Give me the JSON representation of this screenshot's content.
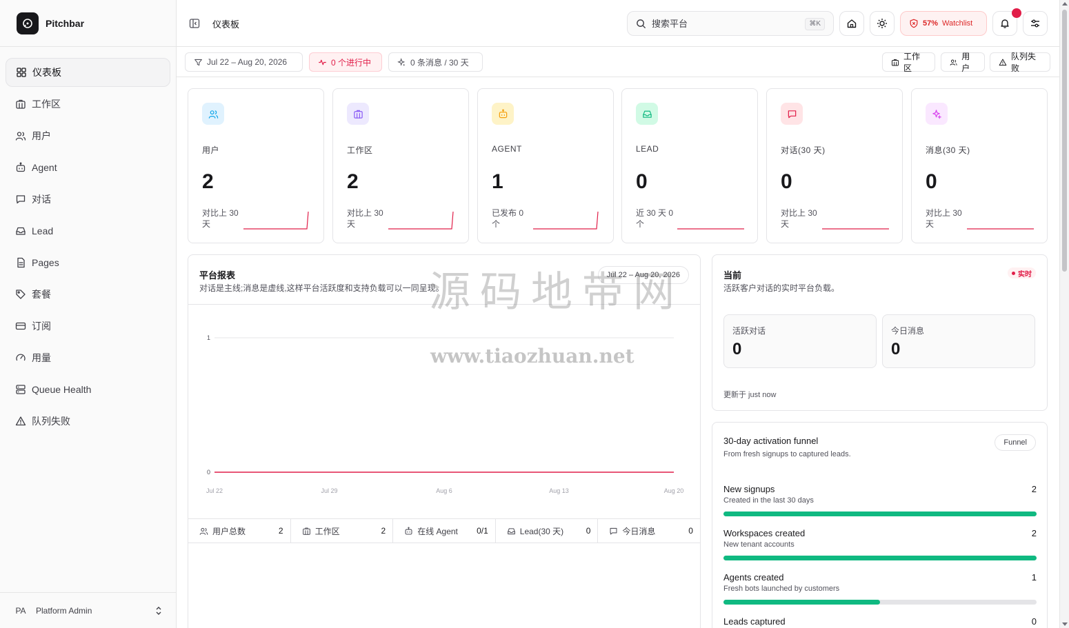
{
  "app": {
    "name": "Pitchbar",
    "page_title": "仪表板"
  },
  "sidebar": {
    "items": [
      {
        "label": "仪表板",
        "icon": "dashboard-icon",
        "active": true
      },
      {
        "label": "工作区",
        "icon": "building-icon"
      },
      {
        "label": "用户",
        "icon": "users-icon"
      },
      {
        "label": "Agent",
        "icon": "bot-icon"
      },
      {
        "label": "对话",
        "icon": "chat-icon"
      },
      {
        "label": "Lead",
        "icon": "inbox-icon"
      },
      {
        "label": "Pages",
        "icon": "document-icon"
      },
      {
        "label": "套餐",
        "icon": "tag-icon"
      },
      {
        "label": "订阅",
        "icon": "card-icon"
      },
      {
        "label": "用量",
        "icon": "gauge-icon"
      },
      {
        "label": "Queue Health",
        "icon": "server-icon"
      },
      {
        "label": "队列失败",
        "icon": "warning-icon"
      }
    ],
    "user": {
      "initials": "PA",
      "name": "Platform Admin"
    }
  },
  "header": {
    "search_placeholder": "搜索平台",
    "search_shortcut": "⌘K",
    "watchlist_percent": "57%",
    "watchlist_label": "Watchlist"
  },
  "filters": {
    "date_range": "Jul 22 – Aug 20, 2026",
    "in_progress": "0 个进行中",
    "messages": "0 条消息 / 30 天",
    "right_buttons": [
      "工作区",
      "用户",
      "队列失败"
    ]
  },
  "stats": [
    {
      "label": "用户",
      "value": "2",
      "note": "对比上 30 天",
      "icon": "users-icon",
      "color": "#0ea5e9",
      "bg": "#e0f2fe"
    },
    {
      "label": "工作区",
      "value": "2",
      "note": "对比上 30 天",
      "icon": "building-icon",
      "color": "#8b5cf6",
      "bg": "#ede9fe"
    },
    {
      "label": "AGENT",
      "value": "1",
      "note": "已发布 0 个",
      "icon": "bot-icon",
      "color": "#f59e0b",
      "bg": "#fef3c7"
    },
    {
      "label": "LEAD",
      "value": "0",
      "note": "近 30 天 0 个",
      "icon": "inbox-icon",
      "color": "#10b981",
      "bg": "#d1fae5"
    },
    {
      "label": "对话(30 天)",
      "value": "0",
      "note": "对比上 30 天",
      "icon": "chat-icon",
      "color": "#e11d48",
      "bg": "#ffe4e6"
    },
    {
      "label": "消息(30 天)",
      "value": "0",
      "note": "对比上 30 天",
      "icon": "sparkle-icon",
      "color": "#d946ef",
      "bg": "#fae8ff"
    }
  ],
  "report": {
    "title": "平台报表",
    "subtitle": "对话是主线;消息是虚线,这样平台活跃度和支持负载可以一同呈现。",
    "date_pill": "Jul 22 – Aug 20, 2026",
    "metrics": [
      {
        "label": "用户总数",
        "value": "2",
        "icon": "users-icon"
      },
      {
        "label": "工作区",
        "value": "2",
        "icon": "building-icon"
      },
      {
        "label": "在线 Agent",
        "value": "0/1",
        "icon": "bot-icon"
      },
      {
        "label": "Lead(30 天)",
        "value": "0",
        "icon": "inbox-icon"
      },
      {
        "label": "今日消息",
        "value": "0",
        "icon": "chat-icon"
      }
    ]
  },
  "chart_data": {
    "type": "line",
    "x_ticks": [
      "Jul 22",
      "Jul 29",
      "Aug 6",
      "Aug 13",
      "Aug 20"
    ],
    "y_ticks": [
      "0",
      "1"
    ],
    "ylim": [
      0,
      1
    ],
    "series": [
      {
        "values": [
          0,
          0,
          0,
          0,
          0
        ],
        "color": "#e11d48"
      }
    ],
    "grid": true
  },
  "live": {
    "title": "当前",
    "subtitle": "活跃客户对话的实时平台负载。",
    "badge": "实时",
    "active_label": "活跃对话",
    "active_value": "0",
    "today_label": "今日消息",
    "today_value": "0",
    "updated": "更新于 just now"
  },
  "funnel": {
    "title": "30-day activation funnel",
    "subtitle": "From fresh signups to captured leads.",
    "pill": "Funnel",
    "steps": [
      {
        "label": "New signups",
        "sub": "Created in the last 30 days",
        "value": "2",
        "fraction": 1.0
      },
      {
        "label": "Workspaces created",
        "sub": "New tenant accounts",
        "value": "2",
        "fraction": 1.0
      },
      {
        "label": "Agents created",
        "sub": "Fresh bots launched by customers",
        "value": "1",
        "fraction": 0.5
      },
      {
        "label": "Leads captured",
        "sub": "",
        "value": "0",
        "fraction": 0
      }
    ]
  },
  "watermark": {
    "cn": "源码地带网",
    "url": "www.tiaozhuan.net"
  }
}
